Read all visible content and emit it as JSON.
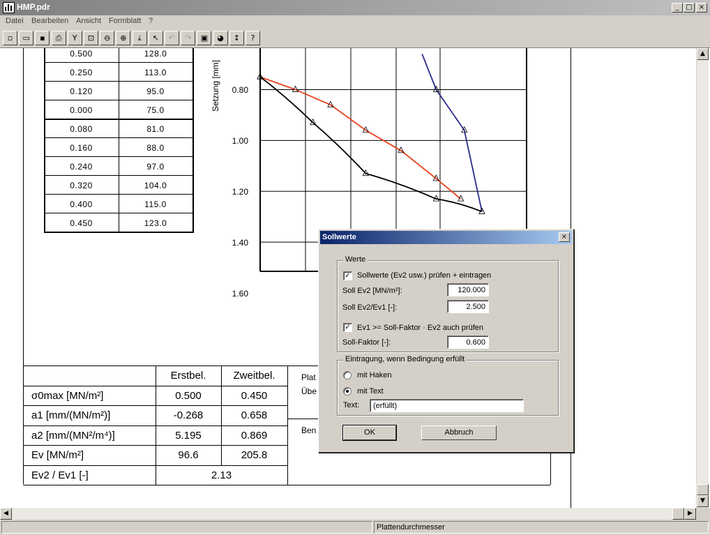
{
  "window": {
    "title": "HMP.pdr"
  },
  "menu": [
    "Datei",
    "Bearbeiten",
    "Ansicht",
    "Formblatt",
    "?"
  ],
  "toolbar": [
    {
      "icon": "new-document-icon",
      "glyph": "▫"
    },
    {
      "icon": "open-folder-icon",
      "glyph": "▭"
    },
    {
      "icon": "save-disk-icon",
      "glyph": "▪"
    },
    {
      "icon": "printer-icon",
      "glyph": "⎙"
    },
    {
      "icon": "tools-icon",
      "glyph": "Y"
    },
    {
      "icon": "zoom-page-icon",
      "glyph": "⊡"
    },
    {
      "icon": "zoom-out-icon",
      "glyph": "⊖"
    },
    {
      "icon": "zoom-in-icon",
      "glyph": "⊕"
    },
    {
      "icon": "insert-icon",
      "glyph": "⤓"
    },
    {
      "icon": "pointer-arrow-icon",
      "glyph": "↖"
    },
    {
      "icon": "undo-icon",
      "glyph": "↶",
      "disabled": true
    },
    {
      "icon": "redo-icon",
      "glyph": "↷",
      "disabled": true
    },
    {
      "icon": "layers-icon",
      "glyph": "▣"
    },
    {
      "icon": "colors-icon",
      "glyph": "◕"
    },
    {
      "icon": "vertical-resize-icon",
      "glyph": "↕"
    },
    {
      "icon": "help-icon",
      "glyph": "?"
    }
  ],
  "load_table": {
    "rows": [
      [
        "0.500",
        "128.0"
      ],
      [
        "0.250",
        "113.0"
      ],
      [
        "0.120",
        "95.0"
      ],
      [
        "0.000",
        "75.0"
      ],
      [
        "0.080",
        "81.0"
      ],
      [
        "0.160",
        "88.0"
      ],
      [
        "0.240",
        "97.0"
      ],
      [
        "0.320",
        "104.0"
      ],
      [
        "0.400",
        "115.0"
      ],
      [
        "0.450",
        "123.0"
      ]
    ]
  },
  "chart_data": {
    "type": "line",
    "ylabel": "Setzung [mm]",
    "ylim": [
      1.6,
      0.7
    ],
    "yticks": [
      "0.80",
      "1.00",
      "1.20",
      "1.40",
      "1.60"
    ],
    "yticks_values": [
      0.8,
      1.0,
      1.2,
      1.4,
      1.6
    ],
    "series": [
      {
        "color": "#e8401c",
        "points": [
          [
            0,
            0.75
          ],
          [
            0.1,
            0.8
          ],
          [
            0.2,
            0.86
          ],
          [
            0.3,
            0.96
          ],
          [
            0.4,
            1.04
          ],
          [
            0.5,
            1.15
          ],
          [
            0.57,
            1.23
          ]
        ]
      },
      {
        "color": "#000000",
        "points": [
          [
            0,
            0.75
          ],
          [
            0.15,
            0.93
          ],
          [
            0.3,
            1.13
          ],
          [
            0.5,
            1.23
          ],
          [
            0.63,
            1.28
          ]
        ]
      },
      {
        "color": "#2a2a8a",
        "points": [
          [
            0.46,
            0.66
          ],
          [
            0.5,
            0.8
          ],
          [
            0.58,
            0.96
          ],
          [
            0.63,
            1.28
          ]
        ]
      }
    ]
  },
  "bottom_table": {
    "headers": [
      "Erstbel.",
      "Zweitbel."
    ],
    "rows": [
      {
        "label": "σ0max [MN/m²]",
        "erst": "0.500",
        "zweit": "0.450"
      },
      {
        "label": "a1 [mm/(MN/m²)]",
        "erst": "-0.268",
        "zweit": "0.658"
      },
      {
        "label": "a2 [mm/(MN²/m⁴)]",
        "erst": "5.195",
        "zweit": "0.869"
      },
      {
        "label": "Ev [MN/m²]",
        "erst": "96.6",
        "zweit": "205.8"
      }
    ],
    "ratio": {
      "label": "Ev2 / Ev1 [-]",
      "value": "2.13"
    },
    "side_labels": [
      "Plat",
      "Übe",
      "Ben"
    ]
  },
  "statusbar": {
    "text": "Plattendurchmesser"
  },
  "dialog": {
    "title": "Sollwerte",
    "group1": {
      "legend": "Werte",
      "check1_label": "Sollwerte (Ev2 usw.) prüfen + eintragen",
      "check1_checked": true,
      "soll_ev2_label": "Soll Ev2 [MN/m²]:",
      "soll_ev2_value": "120.000",
      "soll_ratio_label": "Soll Ev2/Ev1 [-]:",
      "soll_ratio_value": "2.500",
      "check2_label": "Ev1 >= Soll-Faktor · Ev2 auch prüfen",
      "check2_checked": true,
      "soll_faktor_label": "Soll-Faktor [-]:",
      "soll_faktor_value": "0.600"
    },
    "group2": {
      "legend": "Eintragung, wenn Bedingung erfüllt",
      "radio1_label": "mit Haken",
      "radio2_label": "mit Text",
      "selected": "mit Text",
      "text_label": "Text:",
      "text_value": "(erfüllt)"
    },
    "ok_label": "OK",
    "cancel_label": "Abbruch"
  }
}
